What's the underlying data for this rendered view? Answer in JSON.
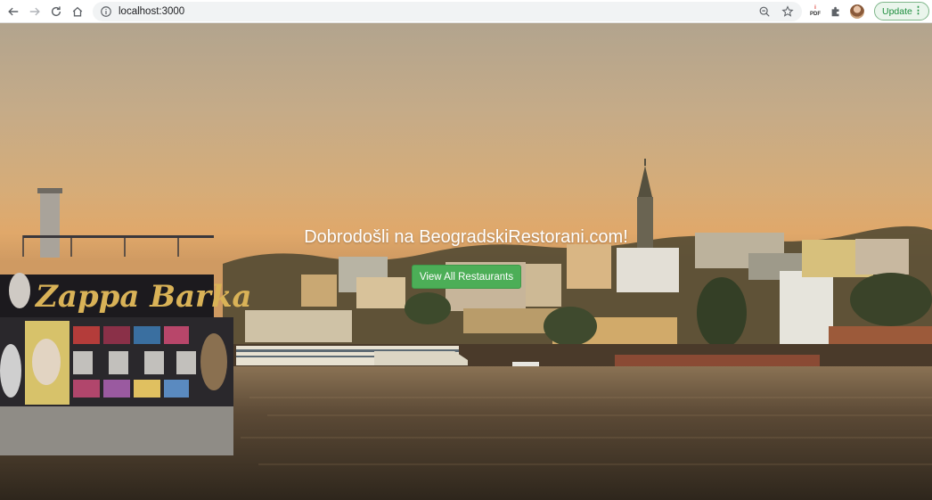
{
  "browser": {
    "url": "localhost:3000",
    "update_label": "Update",
    "pdf_label_top": "PDF",
    "colors": {
      "update_green": "#1e8e3e",
      "omnibox_bg": "#f1f3f4"
    }
  },
  "hero": {
    "title": "Dobrodošli na BeogradskiRestorani.com!",
    "button_label": "View All Restaurants",
    "boat_sign": "Zappa Barka",
    "colors": {
      "button": "#4cae57",
      "sky_top": "#b2a48e",
      "sky_glow": "#e0a86a",
      "water": "#4a3c2c"
    }
  },
  "icons": [
    "back-icon",
    "forward-icon",
    "reload-icon",
    "home-icon",
    "info-icon",
    "zoom-icon",
    "star-icon",
    "pdf-extension-icon",
    "puzzle-icon",
    "avatar",
    "more-vert-icon"
  ]
}
